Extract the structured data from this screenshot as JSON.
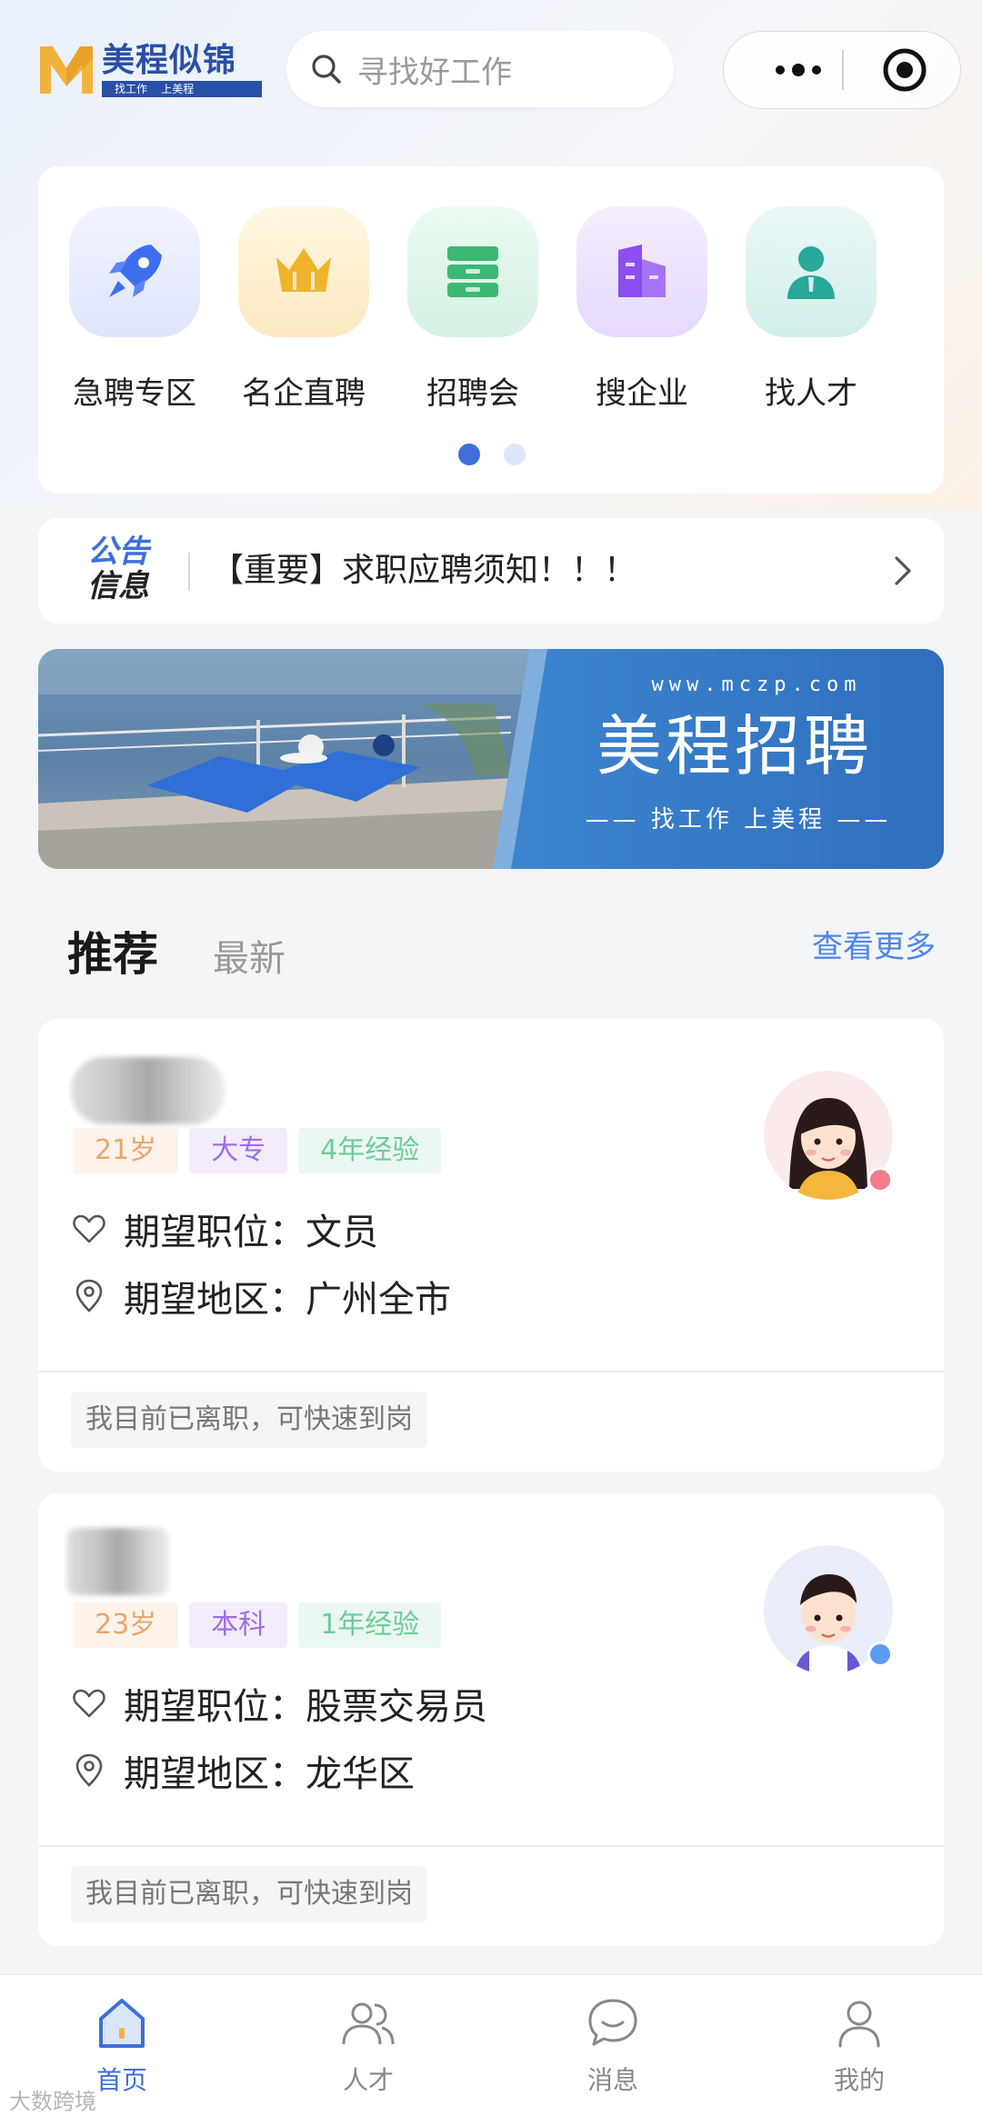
{
  "header": {
    "logo_text": "美程似锦",
    "logo_sub": "找工作    上美程",
    "search_placeholder": "寻找好工作",
    "more_icon": "more-dots-icon",
    "target_icon": "target-icon"
  },
  "categories": [
    {
      "label": "急聘专区",
      "icon": "rocket-icon",
      "bg": "#e6ecfd"
    },
    {
      "label": "名企直聘",
      "icon": "crown-icon",
      "bg": "#fdf1d8"
    },
    {
      "label": "招聘会",
      "icon": "drawer-icon",
      "bg": "#e1f6ea"
    },
    {
      "label": "搜企业",
      "icon": "building-icon",
      "bg": "#efe6fd"
    },
    {
      "label": "找人才",
      "icon": "person-icon",
      "bg": "#e0f4f2"
    }
  ],
  "notice": {
    "badge_line1": "公告",
    "badge_line2": "信息",
    "text": "【重要】求职应聘须知！！！"
  },
  "banner": {
    "url": "www.mczp.com",
    "title": "美程招聘",
    "slogan": "—— 找工作  上美程 ——"
  },
  "section": {
    "tab_recommend": "推荐",
    "tab_latest": "最新",
    "see_more": "查看更多"
  },
  "talents": [
    {
      "age": "21岁",
      "education": "大专",
      "experience": "4年经验",
      "position_label": "期望职位：",
      "position": "文员",
      "region_label": "期望地区：",
      "region": "广州全市",
      "status": "我目前已离职，可快速到岗",
      "gender": "female"
    },
    {
      "age": "23岁",
      "education": "本科",
      "experience": "1年经验",
      "position_label": "期望职位：",
      "position": "股票交易员",
      "region_label": "期望地区：",
      "region": "龙华区",
      "status": "我目前已离职，可快速到岗",
      "gender": "male"
    }
  ],
  "tabbar": [
    {
      "label": "首页",
      "icon": "home-icon",
      "active": true
    },
    {
      "label": "人才",
      "icon": "people-icon",
      "active": false
    },
    {
      "label": "消息",
      "icon": "message-icon",
      "active": false
    },
    {
      "label": "我的",
      "icon": "profile-icon",
      "active": false
    }
  ],
  "watermark": "大数跨境",
  "colors": {
    "accent": "#3f6fd8",
    "brand": "#2a4fa8",
    "link": "#4f86e6"
  }
}
